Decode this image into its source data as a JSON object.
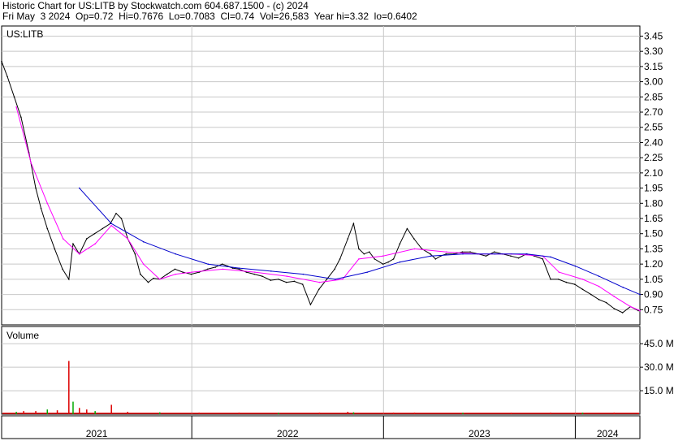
{
  "header": {
    "line1": "Historic Chart for US:LITB by Stockwatch.com 604.687.1500 - (c) 2024",
    "line2": "Fri May  3 2024  Op=0.72  Hi=0.7676  Lo=0.7083  Cl=0.74  Vol=26,583  Year hi=3.32  lo=0.6402"
  },
  "colors": {
    "price": "#000000",
    "ma_short": "#ff00ff",
    "ma_long": "#0000cc",
    "volume_up": "#00aa00",
    "volume_down": "#dd0000",
    "grid": "#c8c8c8",
    "frame": "#000000"
  },
  "chart_data": [
    {
      "type": "line",
      "label": "US:LITB",
      "ytick_labels": [
        "3.45",
        "3.30",
        "3.15",
        "3.00",
        "2.85",
        "2.70",
        "2.55",
        "2.40",
        "2.25",
        "2.10",
        "1.95",
        "1.80",
        "1.65",
        "1.50",
        "1.35",
        "1.20",
        "1.05",
        "0.90",
        "0.75"
      ],
      "ylim": [
        0.6,
        3.55
      ],
      "x_axis_labels": [
        "2021",
        "2022",
        "2023",
        "2024"
      ],
      "x_range": [
        "2021-01-04",
        "2024-05-03"
      ],
      "year_boundaries": [
        "2022-01-01",
        "2023-01-01",
        "2024-01-01"
      ],
      "grid": true,
      "series": [
        {
          "role": "price",
          "x": [
            "2021-01-04",
            "2021-01-15",
            "2021-01-28",
            "2021-02-10",
            "2021-02-25",
            "2021-03-10",
            "2021-03-20",
            "2021-04-01",
            "2021-04-15",
            "2021-04-30",
            "2021-05-12",
            "2021-05-20",
            "2021-06-01",
            "2021-06-15",
            "2021-06-30",
            "2021-07-15",
            "2021-07-30",
            "2021-08-10",
            "2021-08-20",
            "2021-09-01",
            "2021-09-15",
            "2021-09-25",
            "2021-10-10",
            "2021-10-20",
            "2021-11-01",
            "2021-11-15",
            "2021-11-30",
            "2021-12-15",
            "2021-12-31",
            "2022-01-15",
            "2022-01-31",
            "2022-02-15",
            "2022-02-28",
            "2022-03-10",
            "2022-03-20",
            "2022-04-01",
            "2022-04-15",
            "2022-04-30",
            "2022-05-15",
            "2022-05-31",
            "2022-06-15",
            "2022-06-30",
            "2022-07-15",
            "2022-07-31",
            "2022-08-15",
            "2022-08-31",
            "2022-09-15",
            "2022-09-30",
            "2022-10-10",
            "2022-10-25",
            "2022-11-05",
            "2022-11-15",
            "2022-11-25",
            "2022-12-05",
            "2022-12-15",
            "2022-12-31",
            "2023-01-10",
            "2023-01-20",
            "2023-02-01",
            "2023-02-15",
            "2023-02-28",
            "2023-03-15",
            "2023-03-31",
            "2023-04-10",
            "2023-04-20",
            "2023-04-30",
            "2023-05-15",
            "2023-05-31",
            "2023-06-15",
            "2023-06-30",
            "2023-07-15",
            "2023-07-31",
            "2023-08-15",
            "2023-08-31",
            "2023-09-15",
            "2023-09-30",
            "2023-10-15",
            "2023-10-31",
            "2023-11-15",
            "2023-11-30",
            "2023-12-15",
            "2023-12-31",
            "2024-01-15",
            "2024-01-31",
            "2024-02-15",
            "2024-02-29",
            "2024-03-15",
            "2024-03-31",
            "2024-04-15",
            "2024-04-30",
            "2024-05-03"
          ],
          "y": [
            3.2,
            3.05,
            2.85,
            2.65,
            2.3,
            1.95,
            1.75,
            1.55,
            1.35,
            1.15,
            1.05,
            1.4,
            1.3,
            1.45,
            1.5,
            1.55,
            1.6,
            1.7,
            1.65,
            1.45,
            1.3,
            1.1,
            1.02,
            1.06,
            1.05,
            1.1,
            1.15,
            1.12,
            1.1,
            1.12,
            1.15,
            1.17,
            1.2,
            1.18,
            1.16,
            1.15,
            1.12,
            1.1,
            1.08,
            1.04,
            1.05,
            1.02,
            1.03,
            1.0,
            0.8,
            0.95,
            1.05,
            1.15,
            1.25,
            1.45,
            1.6,
            1.35,
            1.3,
            1.32,
            1.25,
            1.2,
            1.22,
            1.25,
            1.4,
            1.55,
            1.45,
            1.35,
            1.3,
            1.25,
            1.28,
            1.3,
            1.3,
            1.32,
            1.32,
            1.3,
            1.28,
            1.32,
            1.3,
            1.28,
            1.26,
            1.3,
            1.28,
            1.25,
            1.05,
            1.05,
            1.02,
            1.0,
            0.95,
            0.9,
            0.85,
            0.82,
            0.76,
            0.72,
            0.78,
            0.74,
            0.74
          ]
        },
        {
          "role": "moving-average-short",
          "x": [
            "2021-02-01",
            "2021-03-01",
            "2021-04-01",
            "2021-05-01",
            "2021-06-01",
            "2021-07-01",
            "2021-08-01",
            "2021-09-01",
            "2021-10-01",
            "2021-11-01",
            "2021-12-01",
            "2022-01-01",
            "2022-03-01",
            "2022-05-01",
            "2022-07-01",
            "2022-09-01",
            "2022-10-15",
            "2022-11-15",
            "2022-12-31",
            "2023-03-01",
            "2023-05-01",
            "2023-07-01",
            "2023-09-01",
            "2023-10-31",
            "2023-12-01",
            "2024-01-15",
            "2024-02-15",
            "2024-03-15",
            "2024-04-15",
            "2024-05-03"
          ],
          "y": [
            2.75,
            2.2,
            1.8,
            1.45,
            1.3,
            1.4,
            1.58,
            1.45,
            1.2,
            1.05,
            1.1,
            1.12,
            1.15,
            1.12,
            1.08,
            1.02,
            1.05,
            1.25,
            1.28,
            1.35,
            1.32,
            1.3,
            1.3,
            1.28,
            1.12,
            1.05,
            0.98,
            0.88,
            0.78,
            0.74
          ]
        },
        {
          "role": "moving-average-long",
          "x": [
            "2021-06-01",
            "2021-08-01",
            "2021-10-01",
            "2021-12-01",
            "2022-02-01",
            "2022-04-01",
            "2022-06-01",
            "2022-08-01",
            "2022-10-01",
            "2022-12-01",
            "2023-02-01",
            "2023-04-01",
            "2023-06-01",
            "2023-08-01",
            "2023-10-01",
            "2023-11-15",
            "2024-01-01",
            "2024-02-15",
            "2024-04-01",
            "2024-05-03"
          ],
          "y": [
            1.95,
            1.6,
            1.42,
            1.3,
            1.2,
            1.16,
            1.13,
            1.1,
            1.05,
            1.12,
            1.22,
            1.28,
            1.3,
            1.3,
            1.3,
            1.27,
            1.18,
            1.08,
            0.97,
            0.9
          ]
        }
      ]
    },
    {
      "type": "bar",
      "label": "Volume",
      "ytick_labels": [
        "45.0 M",
        "30.0 M",
        "15.0 M"
      ],
      "ylim": [
        0,
        56
      ],
      "x": [
        "2021-02-01",
        "2021-02-15",
        "2021-03-10",
        "2021-04-01",
        "2021-04-20",
        "2021-05-12",
        "2021-05-20",
        "2021-06-01",
        "2021-06-15",
        "2021-07-01",
        "2021-08-01",
        "2021-09-01",
        "2021-11-01",
        "2022-01-15",
        "2022-04-01",
        "2022-06-15",
        "2022-09-01",
        "2022-10-25",
        "2022-11-05",
        "2023-01-20",
        "2023-03-01",
        "2023-06-01",
        "2023-09-01",
        "2023-11-15",
        "2024-01-15",
        "2024-03-15",
        "2024-04-30"
      ],
      "values": [
        1.5,
        2,
        2,
        3,
        2.5,
        34,
        8,
        4,
        3,
        2,
        6,
        1.5,
        1.2,
        1.0,
        1.0,
        0.9,
        1.0,
        1.5,
        1.2,
        1.0,
        1.0,
        0.9,
        0.9,
        1.0,
        1.0,
        1.0,
        0.8
      ]
    }
  ]
}
